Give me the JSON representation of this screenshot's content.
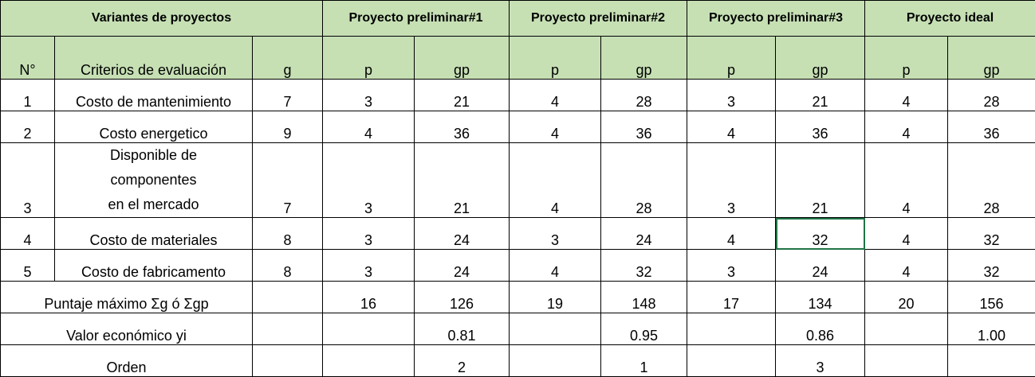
{
  "header": {
    "variants": "Variantes de proyectos",
    "p1": "Proyecto preliminar#1",
    "p2": "Proyecto preliminar#2",
    "p3": "Proyecto preliminar#3",
    "ideal": "Proyecto ideal"
  },
  "sub": {
    "n": "N°",
    "criteria": "Criterios de evaluación",
    "g": "g",
    "p": "p",
    "gp": "gp"
  },
  "rows": [
    {
      "n": "1",
      "criterio": "Costo de mantenimiento",
      "g": "7",
      "p1": "3",
      "gp1": "21",
      "p2": "4",
      "gp2": "28",
      "p3": "3",
      "gp3": "21",
      "pi": "4",
      "gpi": "28"
    },
    {
      "n": "2",
      "criterio": "Costo energetico",
      "g": "9",
      "p1": "4",
      "gp1": "36",
      "p2": "4",
      "gp2": "36",
      "p3": "4",
      "gp3": "36",
      "pi": "4",
      "gpi": "36"
    },
    {
      "n": "3",
      "criterio_lines": [
        "Disponible  de",
        "componentes",
        "en el mercado"
      ],
      "g": "7",
      "p1": "3",
      "gp1": "21",
      "p2": "4",
      "gp2": "28",
      "p3": "3",
      "gp3": "21",
      "pi": "4",
      "gpi": "28"
    },
    {
      "n": "4",
      "criterio": "Costo de materiales",
      "g": "8",
      "p1": "3",
      "gp1": "24",
      "p2": "3",
      "gp2": "24",
      "p3": "4",
      "gp3": "32",
      "pi": "4",
      "gpi": "32"
    },
    {
      "n": "5",
      "criterio": "Costo de fabricamento",
      "g": "8",
      "p1": "3",
      "gp1": "24",
      "p2": "4",
      "gp2": "32",
      "p3": "3",
      "gp3": "24",
      "pi": "4",
      "gpi": "32"
    }
  ],
  "totals": {
    "label": "Puntaje máximo Σg ó Σgp",
    "p1": "16",
    "gp1": "126",
    "p2": "19",
    "gp2": "148",
    "p3": "17",
    "gp3": "134",
    "pi": "20",
    "gpi": "156"
  },
  "econ": {
    "label": "Valor económico yi",
    "gp1": "0.81",
    "gp2": "0.95",
    "gp3": "0.86",
    "gpi": "1.00"
  },
  "order": {
    "label": "Orden",
    "gp1": "2",
    "gp2": "1",
    "gp3": "3"
  },
  "colors": {
    "header_green": "#c6e0b4",
    "selection_border": "#217346"
  }
}
